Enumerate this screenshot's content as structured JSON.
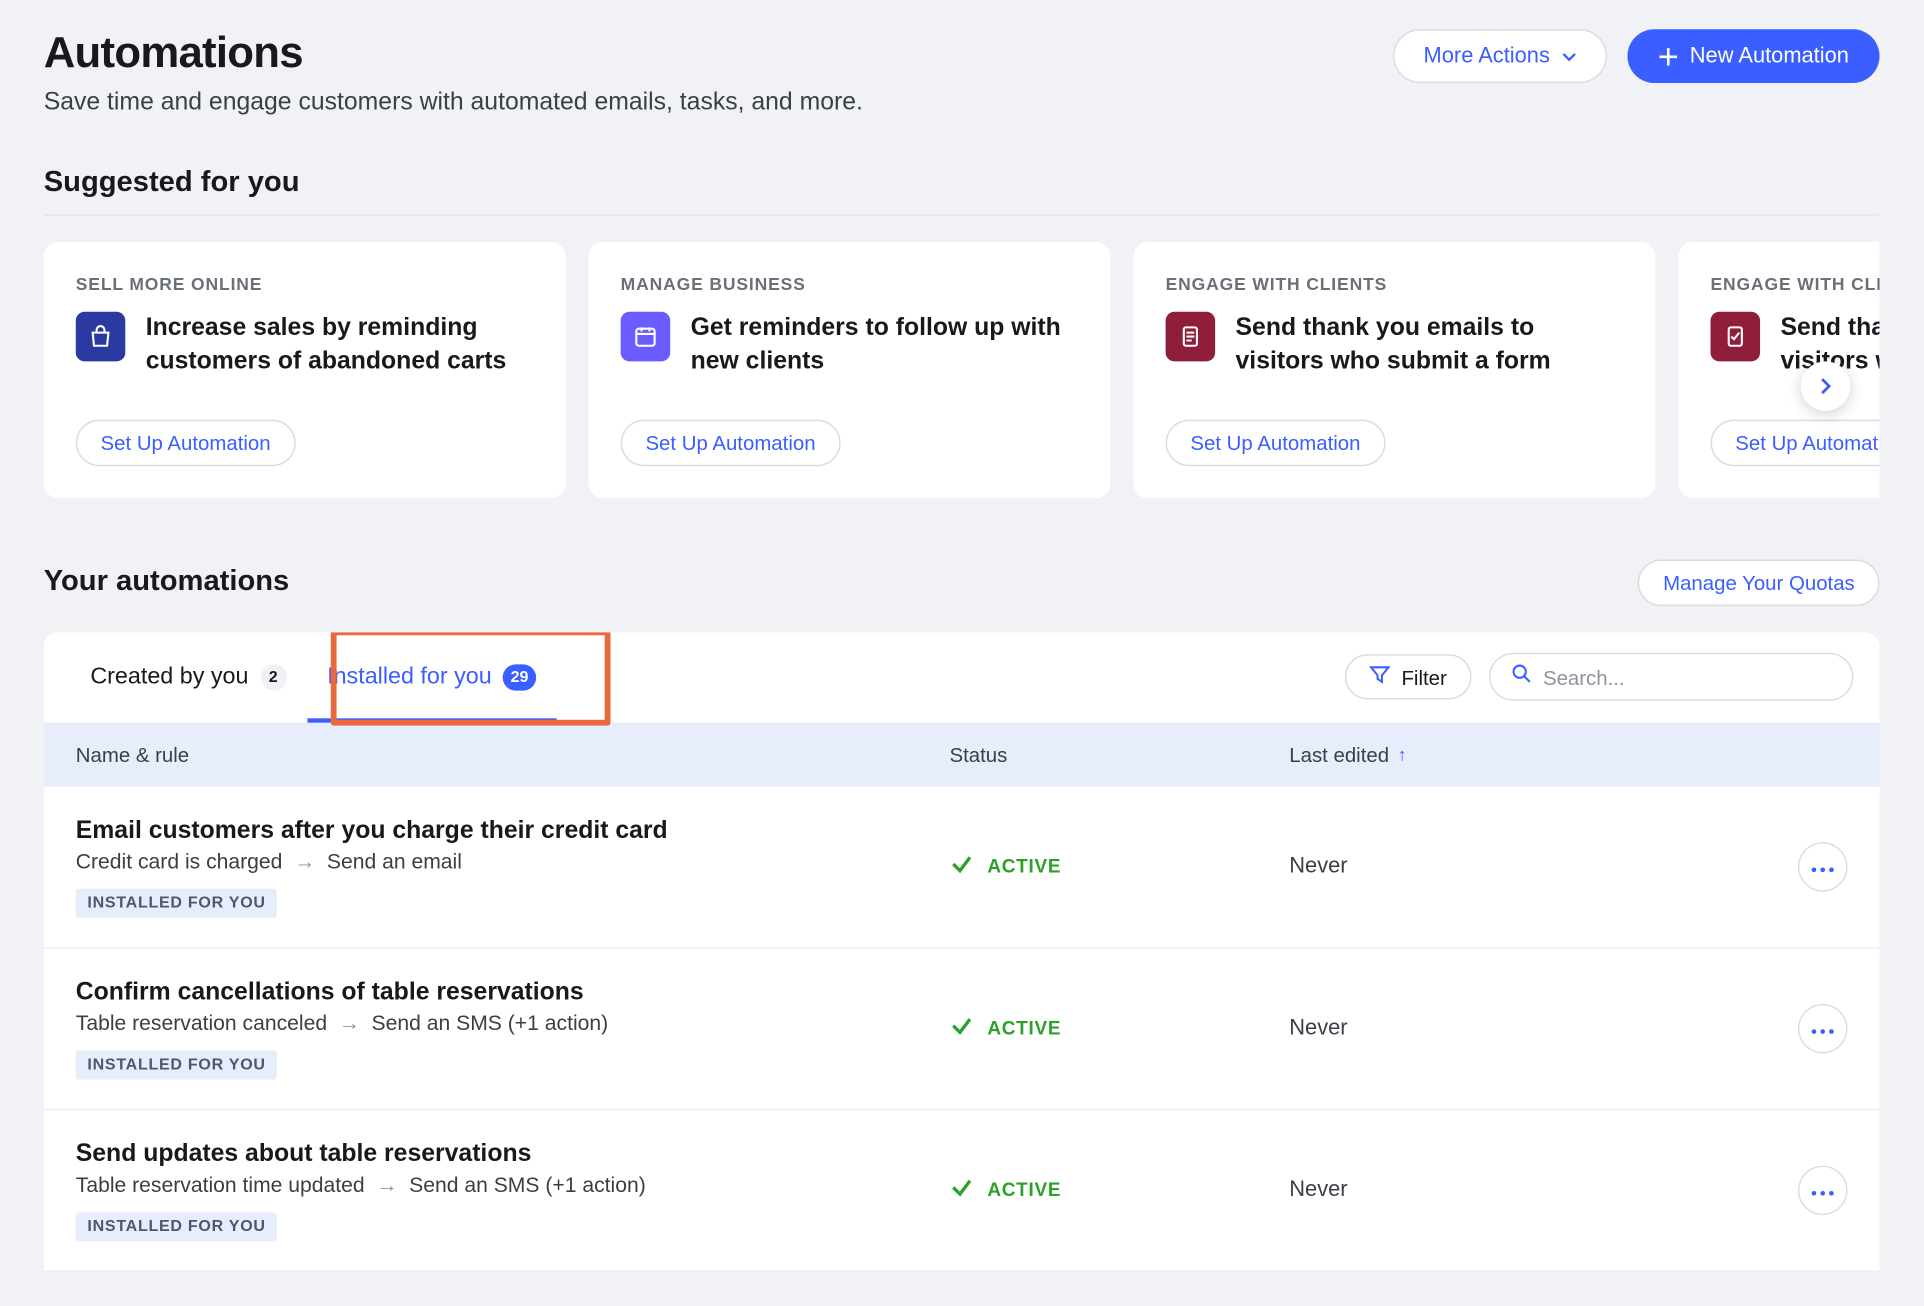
{
  "header": {
    "title": "Automations",
    "subtitle": "Save time and engage customers with automated emails, tasks, and more.",
    "more_actions_label": "More Actions",
    "new_automation_label": "New Automation"
  },
  "suggested": {
    "heading": "Suggested for you",
    "setup_label": "Set Up Automation",
    "cards": [
      {
        "category": "SELL MORE ONLINE",
        "title": "Increase sales by reminding customers of abandoned carts",
        "icon": "bag"
      },
      {
        "category": "MANAGE BUSINESS",
        "title": "Get reminders to follow up with new clients",
        "icon": "cal"
      },
      {
        "category": "ENGAGE WITH CLIENTS",
        "title": "Send thank you emails to visitors who submit a form",
        "icon": "form"
      },
      {
        "category": "ENGAGE WITH CLIENTS",
        "title": "Send thank you emails to visitors who R",
        "icon": "form"
      }
    ]
  },
  "your": {
    "heading": "Your automations",
    "quota_label": "Manage Your Quotas",
    "tabs": {
      "created_label": "Created by you",
      "created_count": "2",
      "installed_label": "Installed for you",
      "installed_count": "29"
    },
    "filter_label": "Filter",
    "search_placeholder": "Search...",
    "columns": {
      "name": "Name & rule",
      "status": "Status",
      "edited": "Last edited"
    },
    "installed_tag": "INSTALLED FOR YOU",
    "status_active": "ACTIVE",
    "rows": [
      {
        "title": "Email customers after you charge their credit card",
        "trigger": "Credit card is charged",
        "action": "Send an email",
        "edited": "Never"
      },
      {
        "title": "Confirm cancellations of table reservations",
        "trigger": "Table reservation canceled",
        "action": "Send an SMS (+1 action)",
        "edited": "Never"
      },
      {
        "title": "Send updates about table reservations",
        "trigger": "Table reservation time updated",
        "action": "Send an SMS (+1 action)",
        "edited": "Never"
      }
    ]
  }
}
